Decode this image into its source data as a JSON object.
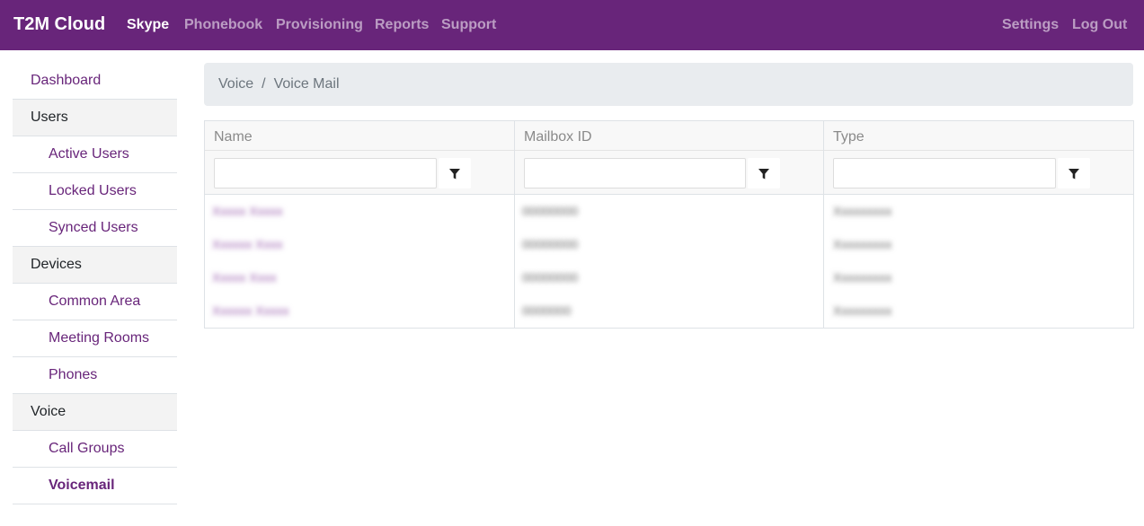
{
  "navbar": {
    "brand": "T2M Cloud",
    "items": [
      {
        "label": "Skype",
        "active": true
      },
      {
        "label": "Phonebook",
        "active": false
      },
      {
        "label": "Provisioning",
        "active": false
      },
      {
        "label": "Reports",
        "active": false
      },
      {
        "label": "Support",
        "active": false
      }
    ],
    "right": [
      {
        "label": "Settings"
      },
      {
        "label": "Log Out"
      }
    ]
  },
  "sidebar": {
    "items": [
      {
        "label": "Dashboard",
        "kind": "top"
      },
      {
        "label": "Users",
        "kind": "group"
      },
      {
        "label": "Active Users",
        "kind": "sub"
      },
      {
        "label": "Locked Users",
        "kind": "sub"
      },
      {
        "label": "Synced Users",
        "kind": "sub"
      },
      {
        "label": "Devices",
        "kind": "group"
      },
      {
        "label": "Common Area",
        "kind": "sub"
      },
      {
        "label": "Meeting Rooms",
        "kind": "sub"
      },
      {
        "label": "Phones",
        "kind": "sub"
      },
      {
        "label": "Voice",
        "kind": "group"
      },
      {
        "label": "Call Groups",
        "kind": "sub"
      },
      {
        "label": "Voicemail",
        "kind": "sub",
        "current": true
      }
    ]
  },
  "breadcrumb": {
    "parent": "Voice",
    "separator": "/",
    "current": "Voice Mail"
  },
  "grid": {
    "columns": [
      "Name",
      "Mailbox ID",
      "Type"
    ],
    "rows": [
      {
        "name": "Xxxxx Xxxxx",
        "mailbox": "00000000",
        "type": "Xxxxxxxxx"
      },
      {
        "name": "Xxxxxx Xxxx",
        "mailbox": "00000000",
        "type": "Xxxxxxxxx"
      },
      {
        "name": "Xxxxx Xxxx",
        "mailbox": "00000000",
        "type": "Xxxxxxxxx"
      },
      {
        "name": "Xxxxxx Xxxxx",
        "mailbox": "0000000",
        "type": "Xxxxxxxxx"
      }
    ]
  },
  "colors": {
    "brand_purple": "#68257a",
    "breadcrumb_bg": "#e9ecef",
    "group_bg": "#f3f3f3",
    "border": "#dee2e6"
  },
  "icons": {
    "filter": "filter-icon"
  }
}
